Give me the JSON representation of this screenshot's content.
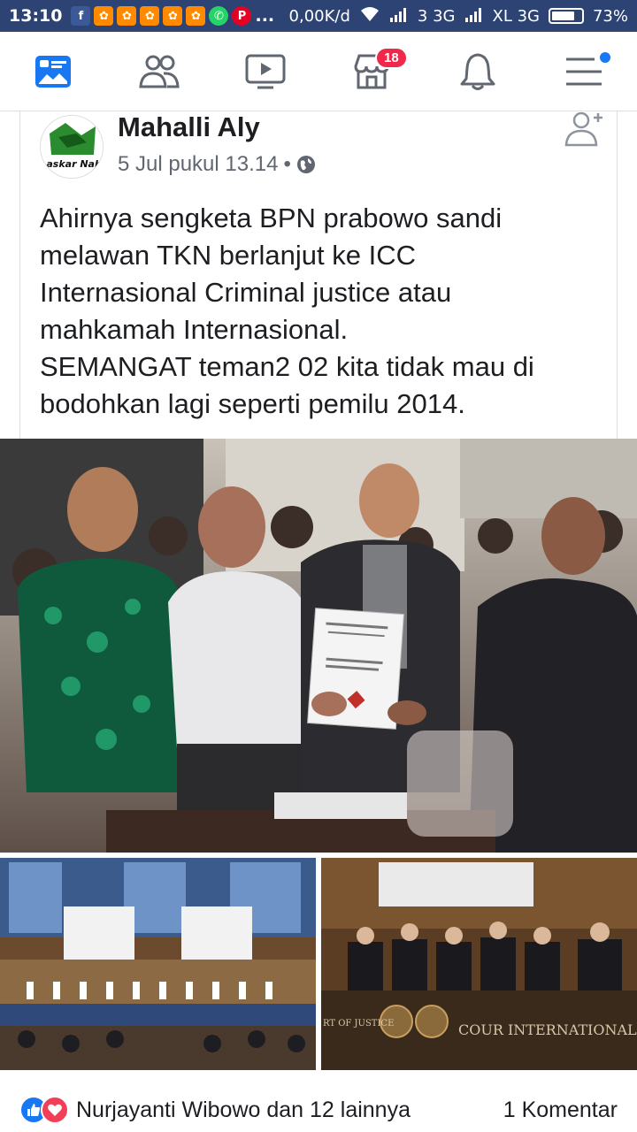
{
  "status_bar": {
    "time": "13:10",
    "speed": "0,00K/d",
    "network1": "3 3G",
    "network2": "XL 3G",
    "battery": "73%",
    "more": "..."
  },
  "nav": {
    "marketplace_badge": "18",
    "items": [
      "news-feed-icon",
      "friends-icon",
      "watch-icon",
      "marketplace-icon",
      "notifications-icon",
      "menu-icon"
    ]
  },
  "post": {
    "author": "Mahalli Aly",
    "avatar_text": "Laskar Nabi",
    "timestamp": "5 Jul pukul 13.14",
    "separator": "•",
    "text_lines": [
      "Ahirnya sengketa BPN prabowo sandi",
      "melawan TKN berlanjut ke ICC",
      "Internasional Criminal justice atau",
      "mahkamah Internasional.",
      "SEMANGAT teman2 02 kita tidak mau di",
      "bodohkan lagi seperti pemilu 2014."
    ]
  },
  "photos": {
    "court_banner": "COUR INTERNATIONALE DE JUSTI",
    "court_banner_left": "RT OF JUSTICE"
  },
  "reactions": {
    "text": "Nurjayanti Wibowo dan 12 lainnya",
    "comments": "1 Komentar"
  },
  "colors": {
    "status_bar": "#2d4373",
    "fb_blue": "#1877f2",
    "badge_red": "#f02849"
  }
}
